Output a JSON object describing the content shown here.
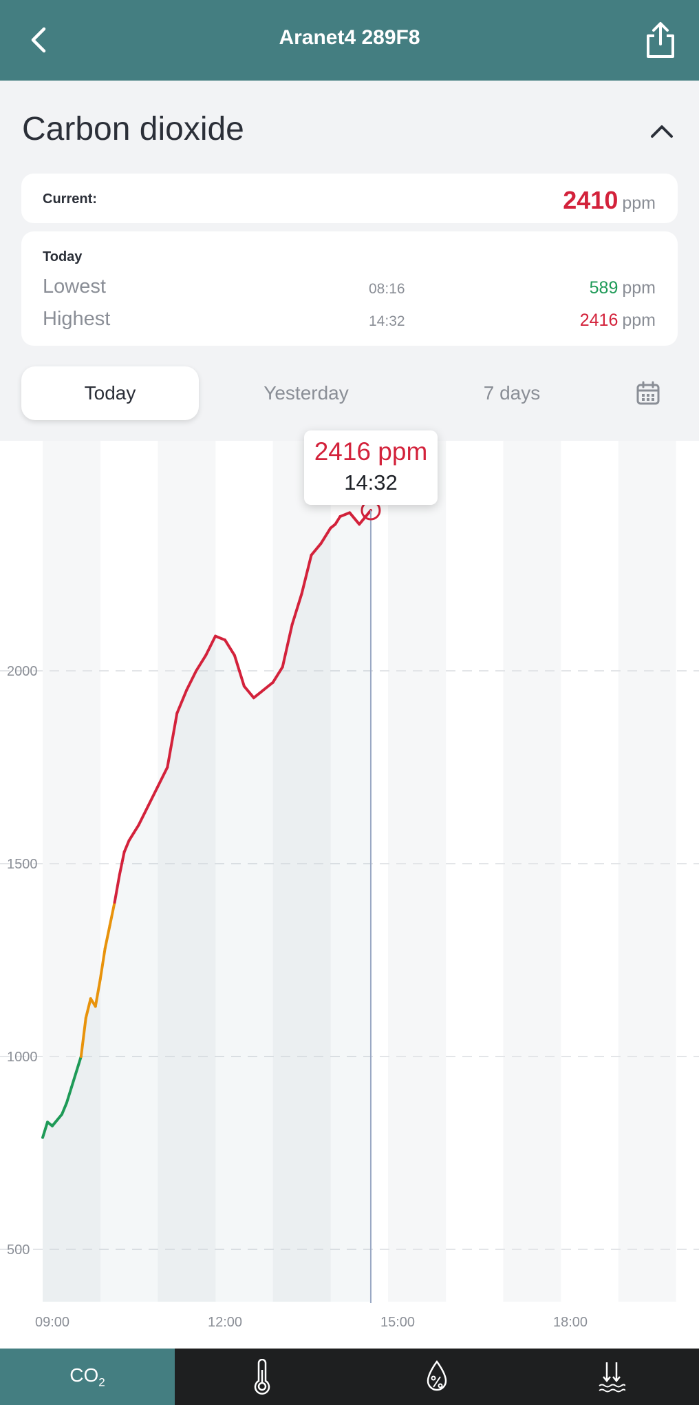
{
  "header": {
    "title": "Aranet4 289F8",
    "back_icon": "back-arrow-icon",
    "share_icon": "share-icon"
  },
  "section": {
    "title": "Carbon dioxide",
    "collapse_icon": "chevron-up-icon"
  },
  "current": {
    "label": "Current:",
    "value": "2410",
    "unit": "ppm"
  },
  "today": {
    "header": "Today",
    "lowest": {
      "label": "Lowest",
      "time": "08:16",
      "value": "589",
      "unit": "ppm"
    },
    "highest": {
      "label": "Highest",
      "time": "14:32",
      "value": "2416",
      "unit": "ppm"
    }
  },
  "range_tabs": [
    {
      "label": "Today",
      "active": true
    },
    {
      "label": "Yesterday",
      "active": false
    },
    {
      "label": "7 days",
      "active": false
    }
  ],
  "calendar_icon": "calendar-icon",
  "tooltip": {
    "value": "2416 ppm",
    "time": "14:32"
  },
  "bottom_nav": {
    "co2_label": "CO",
    "co2_sub": "2",
    "items": [
      "co2",
      "thermometer-icon",
      "humidity-icon",
      "pressure-icon"
    ]
  },
  "colors": {
    "accent": "#447e81",
    "good": "#1e9a57",
    "warn": "#e8930c",
    "bad": "#d3223b"
  },
  "chart_data": {
    "type": "line",
    "title": "",
    "xlabel": "",
    "ylabel": "",
    "x_ticks": [
      "09:00",
      "12:00",
      "15:00",
      "18:00"
    ],
    "y_ticks": [
      500,
      1000,
      1500,
      2000
    ],
    "xlim": [
      "08:50",
      "20:00"
    ],
    "ylim": [
      400,
      2540
    ],
    "grid": true,
    "thresholds": {
      "green_below": 1000,
      "red_from": 1400
    },
    "series": [
      {
        "x": [
          "08:50",
          "08:55",
          "09:00",
          "09:10",
          "09:15",
          "09:20",
          "09:30",
          "09:35",
          "09:40",
          "09:45",
          "09:50",
          "09:55",
          "10:00",
          "10:05",
          "10:10",
          "10:15",
          "10:20",
          "10:25",
          "10:30",
          "10:40",
          "10:50",
          "11:00",
          "11:10",
          "11:20",
          "11:30",
          "11:40",
          "11:50",
          "12:00",
          "12:10",
          "12:15",
          "12:20",
          "12:30",
          "12:40",
          "12:50",
          "13:00",
          "13:10",
          "13:20",
          "13:30",
          "13:40",
          "13:50",
          "13:55",
          "14:00",
          "14:10",
          "14:20",
          "14:30",
          "14:32"
        ],
        "y": [
          790,
          830,
          820,
          850,
          880,
          920,
          1000,
          1100,
          1150,
          1130,
          1200,
          1280,
          1340,
          1400,
          1470,
          1530,
          1560,
          1580,
          1600,
          1650,
          1700,
          1750,
          1890,
          1950,
          2000,
          2040,
          2090,
          2080,
          2040,
          2000,
          1960,
          1930,
          1950,
          1970,
          2010,
          2120,
          2200,
          2300,
          2330,
          2370,
          2380,
          2400,
          2410,
          2380,
          2410,
          2416
        ]
      }
    ]
  }
}
